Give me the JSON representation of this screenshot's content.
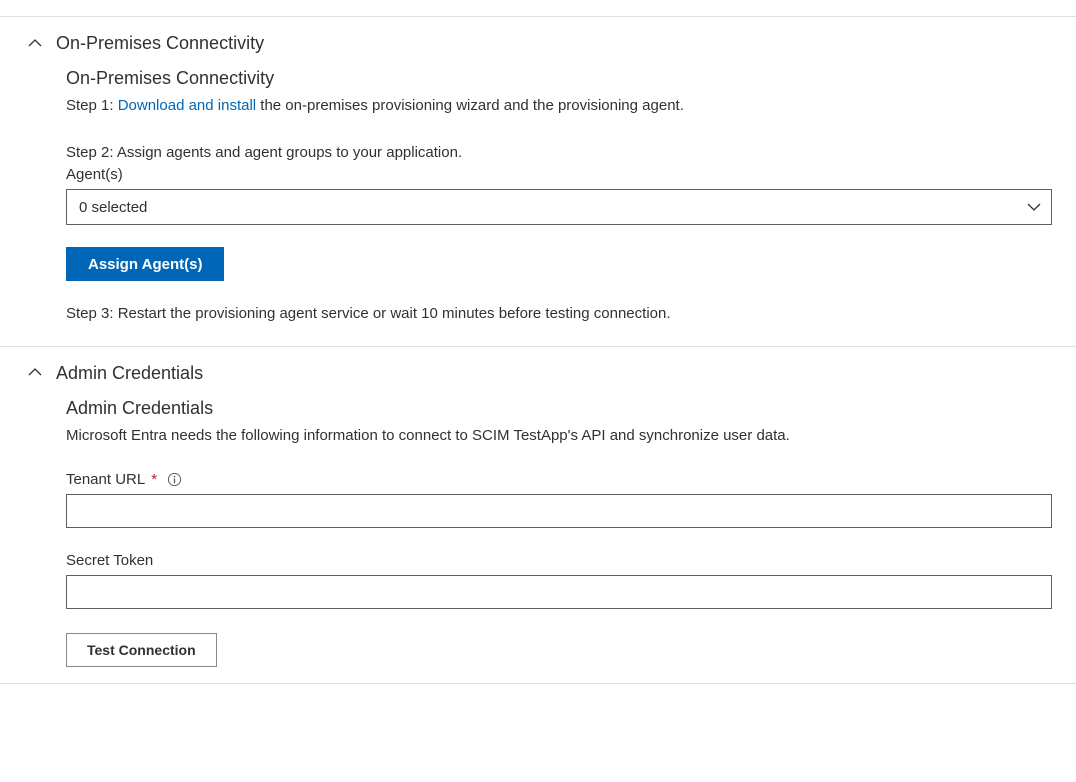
{
  "section1": {
    "header_title": "On-Premises Connectivity",
    "subtitle": "On-Premises Connectivity",
    "step1_prefix": "Step 1: ",
    "step1_link": "Download and install",
    "step1_suffix": " the on-premises provisioning wizard and the provisioning agent.",
    "step2_text": "Step 2: Assign agents and agent groups to your application.",
    "agents_label": "Agent(s)",
    "agents_selected": "0 selected",
    "assign_button": "Assign Agent(s)",
    "step3_text": "Step 3: Restart the provisioning agent service or wait 10 minutes before testing connection."
  },
  "section2": {
    "header_title": "Admin Credentials",
    "subtitle": "Admin Credentials",
    "description": "Microsoft Entra needs the following information to connect to SCIM TestApp's API and synchronize user data.",
    "tenant_url_label": "Tenant URL",
    "required_mark": "*",
    "tenant_url_value": "",
    "secret_token_label": "Secret Token",
    "secret_token_value": "",
    "test_connection_button": "Test Connection"
  }
}
